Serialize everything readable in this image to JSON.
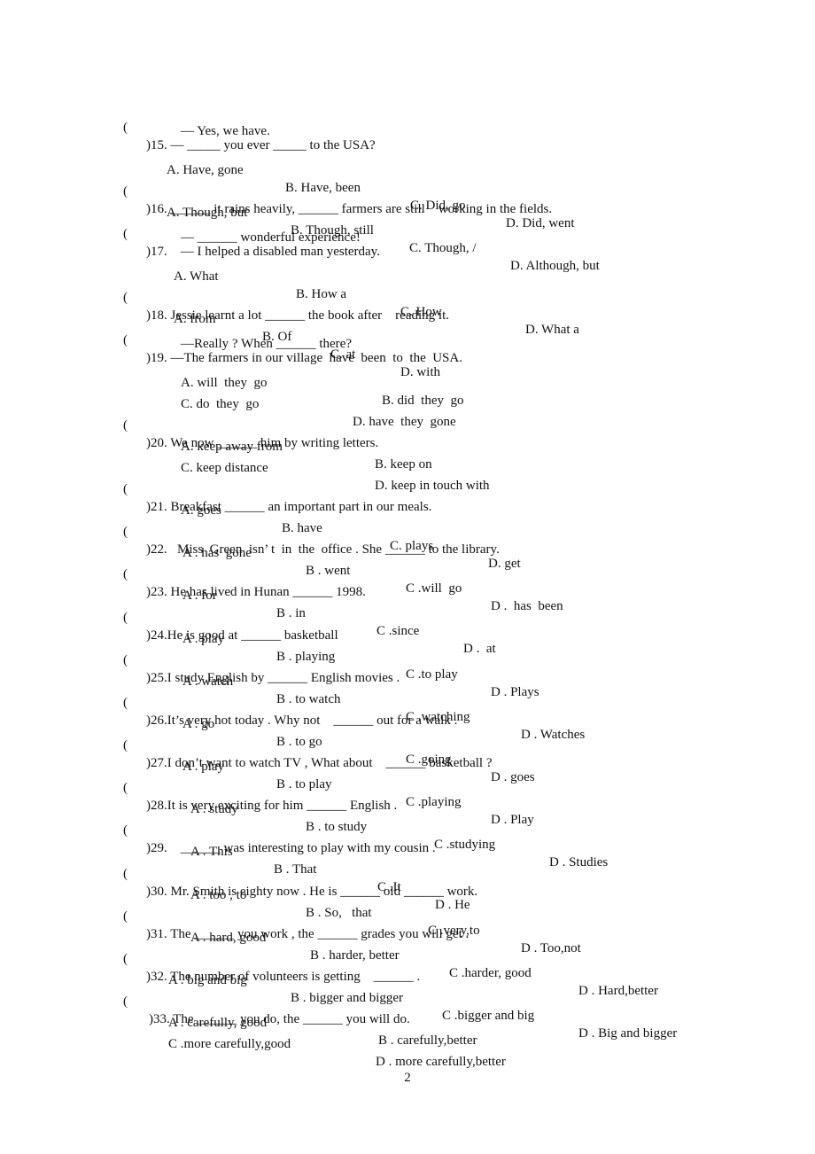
{
  "page_number": "2",
  "questions": [
    {
      "num": "15",
      "stem": ")15. — _____ you ever _____ to the USA?",
      "sub": [
        "— Yes, we have."
      ],
      "options": [
        "A. Have, gone",
        "B. Have, been",
        "C. Did, go",
        "D. Did, went"
      ]
    },
    {
      "num": "16",
      "stem": ")16. ______ it rains heavily, ______ farmers are still    working in the fields.",
      "sub": [],
      "options": [
        "A. Though, but",
        "B. Though, still",
        "C. Though, /",
        "D. Although, but"
      ]
    },
    {
      "num": "17",
      "stem": ")17.    — I helped a disabled man yesterday.",
      "sub": [
        "— ______ wonderful experience!"
      ],
      "options": [
        "A. What",
        "B. How a",
        "C. How",
        "D. What a"
      ]
    },
    {
      "num": "18",
      "stem": ")18. Jessie learnt a lot ______ the book after    reading it.",
      "sub": [],
      "options": [
        "A. from",
        "B. Of",
        "C. at",
        "D. with"
      ]
    },
    {
      "num": "19",
      "stem": ")19. —The farmers in our village  have  been  to  the  USA.",
      "sub": [
        "—Really ? When ______ there?"
      ],
      "options": [
        "A. will  they  go",
        "B. did  they  go",
        "C. do  they  go",
        "D. have  they  gone"
      ]
    },
    {
      "num": "20",
      "stem": ")20. We now ______ him by writing letters.",
      "sub": [],
      "options": [
        "A. keep away from",
        "B. keep on",
        "C. keep distance",
        "D. keep in touch with"
      ]
    },
    {
      "num": "21",
      "stem": ")21. Breakfast ______ an important part in our meals.",
      "sub": [],
      "options": [
        "A. goes",
        "B. have",
        "C. plays",
        "D. get"
      ]
    },
    {
      "num": "22",
      "stem": ")22.   Miss  Green  isn’ t  in  the  office . She ______ to the library.",
      "sub": [],
      "options": [
        "A . has  gone",
        "B . went",
        "C .will  go",
        "D .  has  been"
      ]
    },
    {
      "num": "23",
      "stem": ")23. He has lived in Hunan ______ 1998.",
      "sub": [],
      "options": [
        "A . for",
        "B . in",
        "C .since",
        "D .  at"
      ]
    },
    {
      "num": "24",
      "stem": ")24.He is good at ______ basketball",
      "sub": [],
      "options": [
        "A . play",
        "B . playing",
        "C .to play",
        "D . Plays"
      ]
    },
    {
      "num": "25",
      "stem": ")25.I study English by ______ English movies .",
      "sub": [],
      "options": [
        "A . watch",
        "B . to watch",
        "C .watching",
        "D . Watches"
      ]
    },
    {
      "num": "26",
      "stem": ")26.It’s very hot today . Why not    ______ out for a walk .",
      "sub": [],
      "options": [
        "A . go",
        "B . to go",
        "C .going",
        "D . goes"
      ]
    },
    {
      "num": "27",
      "stem": ")27.I don’t want to watch TV , What about    ______ basketball ?",
      "sub": [],
      "options": [
        "A . play",
        "B . to play",
        "C .playing",
        "D . Play"
      ]
    },
    {
      "num": "28",
      "stem": ")28.It is very exciting for him ______ English .",
      "sub": [],
      "options": [
        "A . study",
        "B . to study",
        "C .studying",
        "D . Studies"
      ]
    },
    {
      "num": "29",
      "stem": ")29.    ______ was interesting to play with my cousin .",
      "sub": [],
      "options": [
        "A . This",
        "B . That",
        "C .It",
        "D . He"
      ]
    },
    {
      "num": "30",
      "stem": ")30. Mr. Smith is eighty now . He is ______ old ______ work.",
      "sub": [],
      "options": [
        "A . too , to",
        "B . So,   that",
        "C .very,to",
        "D . Too,not"
      ]
    },
    {
      "num": "31",
      "stem": ")31. The ______ you work , the ______ grades you will get .",
      "sub": [],
      "options": [
        "A . hard, good",
        "B . harder, better",
        "C .harder, good",
        "D . Hard,better"
      ]
    },
    {
      "num": "32",
      "stem": ")32. The number of volunteers is getting    ______ .",
      "sub": [],
      "options": [
        "A . big and big",
        "B . bigger and bigger",
        "C .bigger and big",
        "D . Big and bigger"
      ]
    },
    {
      "num": "33",
      "stem": ")33. The ______ you do, the ______ you will do.",
      "sub": [],
      "options": [
        "A . carefully, good",
        "B . carefully,better",
        "C .more carefully,good",
        "D . more carefully,better"
      ]
    }
  ]
}
